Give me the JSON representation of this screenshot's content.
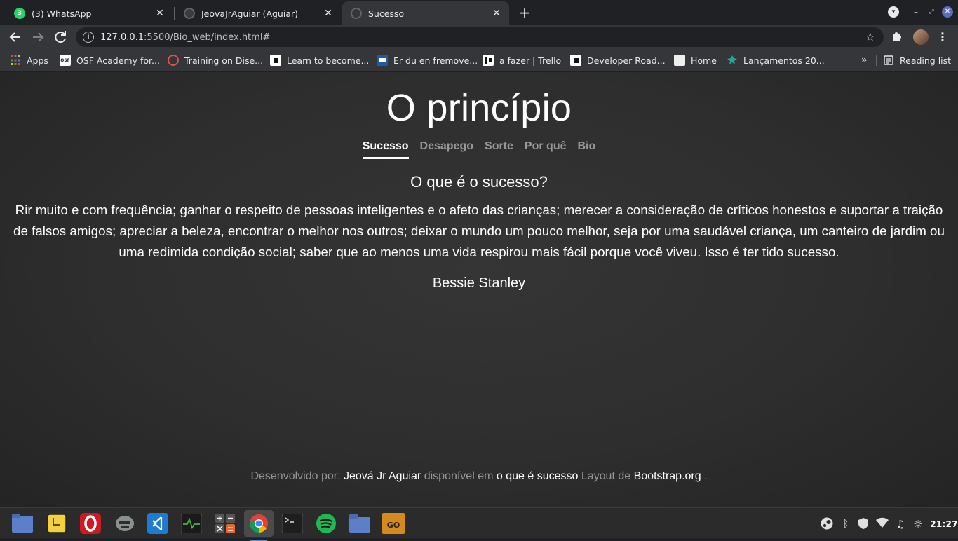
{
  "browser": {
    "tabs": [
      {
        "title": "(3) WhatsApp",
        "icon": "whatsapp-icon",
        "active": false
      },
      {
        "title": "JeovaJrAguiar (Aguiar)",
        "icon": "github-icon",
        "active": false
      },
      {
        "title": "Sucesso",
        "icon": "globe-icon",
        "active": true
      }
    ],
    "close_glyph": "✕",
    "new_tab_glyph": "+",
    "url_host": "127.0.0.1",
    "url_rest": ":5500/Bio_web/index.html#",
    "bookmarks": [
      {
        "label": "Apps",
        "icon": "apps-grid-icon"
      },
      {
        "label": "OSF Academy for...",
        "icon": "osf-icon",
        "icon_text": "OSF"
      },
      {
        "label": "Training on Dise...",
        "icon": "training-icon"
      },
      {
        "label": "Learn to become...",
        "icon": "roadmap-icon"
      },
      {
        "label": "Er du en fremove...",
        "icon": "book-icon"
      },
      {
        "label": "a fazer | Trello",
        "icon": "trello-icon"
      },
      {
        "label": "Developer Road...",
        "icon": "roadmap-icon"
      },
      {
        "label": "Home",
        "icon": "home-page-icon"
      },
      {
        "label": "Lançamentos 20...",
        "icon": "leaf-icon"
      }
    ],
    "bookmarks_overflow": "»",
    "reading_list": "Reading list"
  },
  "page": {
    "brand": "O princípio",
    "nav": [
      {
        "label": "Sucesso",
        "active": true
      },
      {
        "label": "Desapego",
        "active": false
      },
      {
        "label": "Sorte",
        "active": false
      },
      {
        "label": "Por quê",
        "active": false
      },
      {
        "label": "Bio",
        "active": false
      }
    ],
    "heading": "O que é o sucesso?",
    "quote": "Rir muito e com frequência; ganhar o respeito de pessoas inteligentes e o afeto das crianças; merecer a consideração de críticos honestos e suportar a traição de falsos amigos; apreciar a beleza, encontrar o melhor nos outros; deixar o mundo um pouco melhor, seja por uma saudável criança, um canteiro de jardim ou uma redimida condição social; saber que ao menos uma vida respirou mais fácil porque você viveu. Isso é ter tido sucesso.",
    "author": "Bessie Stanley",
    "footer": {
      "prefix": "Desenvolvido por:",
      "author_link": "Jeová Jr Aguiar",
      "middle": "disponível em",
      "site_link": "o que é sucesso",
      "layout_text": "Layout de",
      "bootstrap_link": "Bootstrap.org",
      "suffix": "."
    }
  },
  "taskbar": {
    "apps": [
      "files-icon",
      "notes-icon",
      "opera-icon",
      "system-monitor-face-icon",
      "vscode-icon",
      "activity-monitor-icon",
      "calculator-icon",
      "chrome-icon",
      "terminal-icon",
      "spotify-icon",
      "folder-icon",
      "csgo-icon"
    ],
    "active_app": "chrome-icon",
    "clock": "21:27"
  },
  "colors": {
    "accent_chrome": "#8ab4f8",
    "whatsapp": "#25d366",
    "page_bg": "#333333"
  }
}
